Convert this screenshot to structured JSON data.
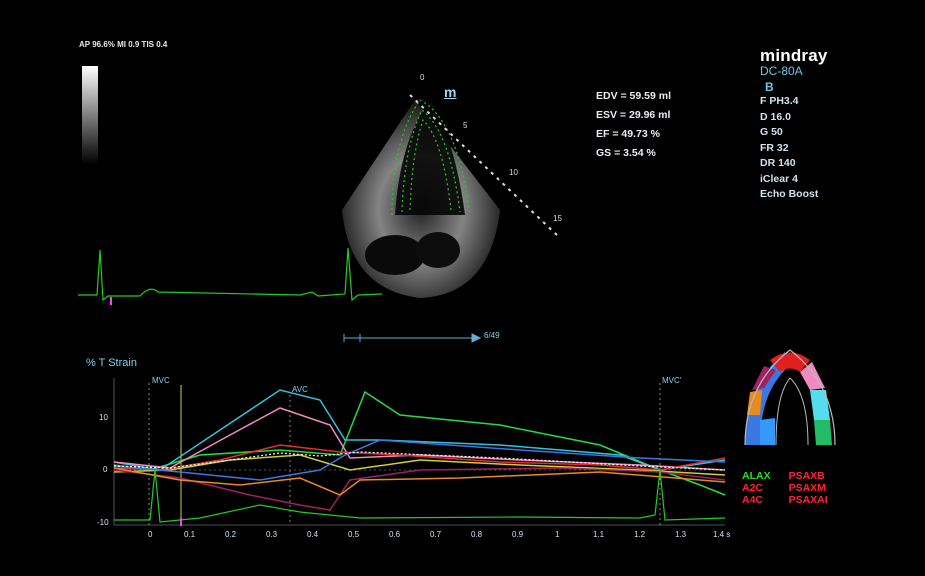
{
  "status_bar": "AP 96.6%  MI 0.9 TIS 0.4",
  "brand": {
    "name": "mindray",
    "model": "DC-80A",
    "mode": "B"
  },
  "params": [
    "F PH3.4",
    "D 16.0",
    "G 50",
    "FR 32",
    "DR 140",
    "iClear 4",
    "Echo Boost"
  ],
  "measurements": [
    "EDV = 59.59 ml",
    "ESV = 29.96 ml",
    "EF  = 49.73 %",
    "GS = 3.54 %"
  ],
  "m_marker": "m",
  "depth_scale": [
    "0",
    "5",
    "10",
    "15"
  ],
  "frame_counter": "6/49",
  "strain_plot": {
    "ylabel": "% T Strain",
    "y_ticks": [
      "10",
      "0",
      "-10"
    ],
    "x_ticks": [
      "0",
      "0.1",
      "0.2",
      "0.3",
      "0.4",
      "0.5",
      "0.6",
      "0.7",
      "0.8",
      "0.9",
      "1",
      "1.1",
      "1.2",
      "1.3",
      "1.4 s"
    ],
    "events": [
      "MVC",
      "AVC",
      "MVC'"
    ]
  },
  "legend": {
    "col1": [
      "ALAX",
      "A2C",
      "A4C"
    ],
    "col2": [
      "PSAXB",
      "PSAXM",
      "PSAXAI"
    ]
  },
  "colors": {
    "green": "#22dd22",
    "red": "#ff2233",
    "cyan": "#7dd3f0"
  }
}
